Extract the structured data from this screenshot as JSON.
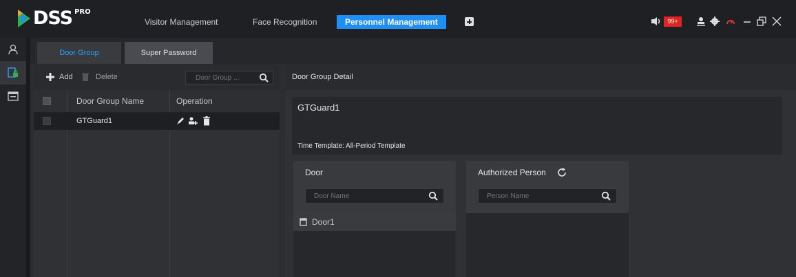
{
  "app": {
    "logo_text": "DSS",
    "logo_sup": "PRO"
  },
  "nav": {
    "tabs": [
      {
        "label": "Visitor Management"
      },
      {
        "label": "Face Recognition"
      },
      {
        "label": "Personnel Management"
      }
    ],
    "active_tab": "Personnel Management"
  },
  "topright": {
    "notification_count": "99+",
    "accent_color": "#1e8ff5",
    "badge_color": "#e32222"
  },
  "subtabs": {
    "door_group": "Door Group",
    "super_password": "Super Password"
  },
  "toolbar": {
    "add_label": "Add",
    "delete_label": "Delete",
    "search_placeholder": "Door Group ..."
  },
  "table": {
    "columns": [
      "Door Group Name",
      "Operation"
    ],
    "rows": [
      {
        "name": "GTGuard1"
      }
    ]
  },
  "detail": {
    "header": "Door Group Detail",
    "group_name": "GTGuard1",
    "time_template": "Time Template: All-Period Template"
  },
  "door_card": {
    "title": "Door",
    "search_placeholder": "Door Name",
    "items": [
      "Door1"
    ]
  },
  "person_card": {
    "title": "Authorized Person",
    "search_placeholder": "Person Name"
  }
}
